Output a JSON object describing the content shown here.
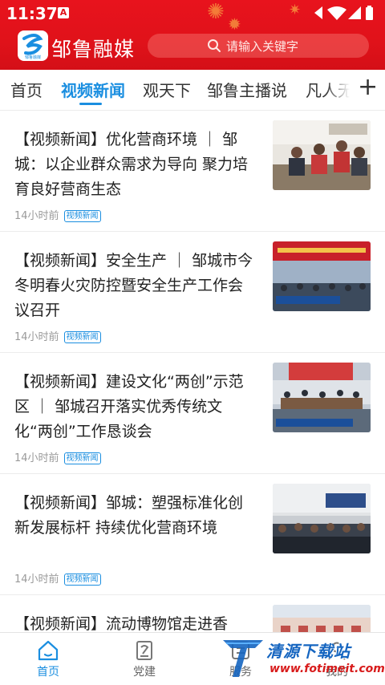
{
  "status_bar": {
    "time": "11:37",
    "notification_glyph": "A"
  },
  "header": {
    "app_title": "邹鲁融媒",
    "logo_caption": "邹鲁融媒",
    "search_placeholder": "请输入关键字"
  },
  "tabs": [
    {
      "label": "首页"
    },
    {
      "label": "视频新闻"
    },
    {
      "label": "观天下"
    },
    {
      "label": "邹鲁主播说"
    },
    {
      "label": "凡人无"
    }
  ],
  "tab_add_glyph": "+",
  "news": [
    {
      "title": "【视频新闻】优化营商环境 ｜ 邹城：以企业群众需求为导向 聚力培育良好营商生态",
      "time": "14小时前",
      "tag": "视频新闻",
      "thumb_icon": "meeting-photo-icon"
    },
    {
      "title": "【视频新闻】安全生产 ｜ 邹城市今冬明春火灾防控暨安全生产工作会议召开",
      "time": "14小时前",
      "tag": "视频新闻",
      "thumb_icon": "conference-photo-icon"
    },
    {
      "title": "【视频新闻】建设文化“两创”示范区 ｜ 邹城召开落实优秀传统文化“两创”工作恳谈会",
      "time": "14小时前",
      "tag": "视频新闻",
      "thumb_icon": "conference-photo-icon"
    },
    {
      "title": "【视频新闻】邹城：塑强标准化创新发展标杆 持续优化营商环境",
      "time": "14小时前",
      "tag": "视频新闻",
      "thumb_icon": "conference-photo-icon"
    },
    {
      "title": "【视频新闻】流动博物馆走进香",
      "time": "",
      "tag": "",
      "thumb_icon": "building-photo-icon"
    }
  ],
  "bottom_nav": [
    {
      "label": "首页",
      "icon": "home-icon",
      "active": true
    },
    {
      "label": "党建",
      "icon": "party-building-icon",
      "active": false
    },
    {
      "label": "服务",
      "icon": "service-icon",
      "active": false
    },
    {
      "label": "我的",
      "icon": "profile-icon",
      "active": false
    }
  ],
  "watermark": {
    "title": "清源下载站",
    "url": "www.fotimeit.com"
  },
  "colors": {
    "header_red": "#e0121a",
    "accent_blue": "#1a8ee0",
    "text_dark": "#222222",
    "text_gray": "#9a9a9a"
  }
}
